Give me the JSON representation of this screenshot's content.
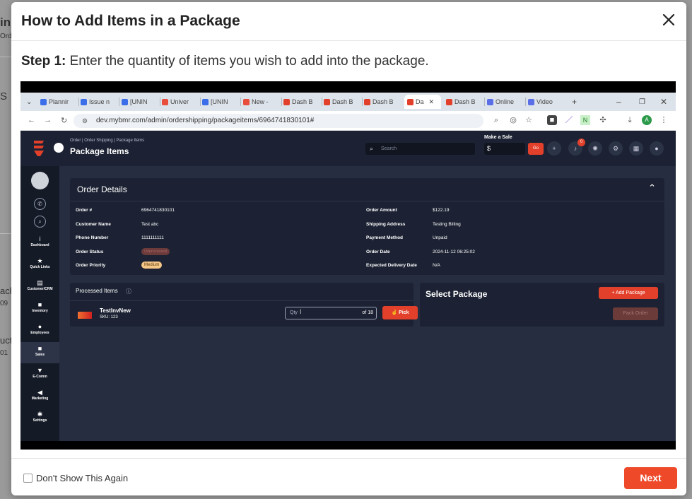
{
  "background": {
    "fragments": [
      "in",
      "Ord",
      "S",
      "ach",
      "09",
      "uct",
      "01"
    ]
  },
  "modal": {
    "title": "How to Add Items in a Package",
    "step_label": "Step 1:",
    "step_text": " Enter the quantity of items you wish to add into the package.",
    "footer": {
      "checkbox_label": "Don't Show This Again",
      "next_label": "Next"
    }
  },
  "browser": {
    "tabs": [
      {
        "label": "Plannir",
        "color": "#3b6ee8"
      },
      {
        "label": "Issue n",
        "color": "#3b6ee8"
      },
      {
        "label": "[UNIN",
        "color": "#3b6ee8"
      },
      {
        "label": "Univer",
        "color": "#e84e3b"
      },
      {
        "label": "[UNIN",
        "color": "#3b6ee8"
      },
      {
        "label": "New -",
        "color": "#e84e3b"
      },
      {
        "label": "Dash B",
        "color": "#e2402b"
      },
      {
        "label": "Dash B",
        "color": "#e2402b"
      },
      {
        "label": "Dash B",
        "color": "#e2402b"
      },
      {
        "label": "Da",
        "color": "#e2402b"
      },
      {
        "label": "Dash B",
        "color": "#e2402b"
      },
      {
        "label": "Online",
        "color": "#5a6ee8"
      },
      {
        "label": "Video",
        "color": "#5a6ee8"
      }
    ],
    "url": "dev.mybmr.com/admin/ordershipping/packageitems/6964741830101#",
    "profile_initial": "A"
  },
  "app": {
    "breadcrumb": "Order | Order Shipping | Package Items",
    "title": "Package Items",
    "search_placeholder": "Search",
    "make_sale_label": "Make a Sale",
    "sale_currency": "$",
    "go_label": "Go",
    "notif_count": "0",
    "sidebar": [
      {
        "label": "Dashboard",
        "icon": "i"
      },
      {
        "label": "Quick Links",
        "icon": "★"
      },
      {
        "label": "Customer/CRM",
        "icon": "▤"
      },
      {
        "label": "Inventory",
        "icon": "■"
      },
      {
        "label": "Employees",
        "icon": "●"
      },
      {
        "label": "Sales",
        "icon": "■"
      },
      {
        "label": "E-Comm",
        "icon": "▼"
      },
      {
        "label": "Marketing",
        "icon": "◀"
      },
      {
        "label": "Settings",
        "icon": "✱"
      }
    ],
    "order_details": {
      "title": "Order Details",
      "left": [
        {
          "label": "Order #",
          "value": "6964741830101"
        },
        {
          "label": "Customer Name",
          "value": "Test abc"
        },
        {
          "label": "Phone Number",
          "value": "1111111111"
        },
        {
          "label": "Order Status",
          "value": "Unprocessed"
        },
        {
          "label": "Order Priority",
          "value": "Medium"
        }
      ],
      "right": [
        {
          "label": "Order Amount",
          "value": "$122.19"
        },
        {
          "label": "Shipping Address",
          "value": "Testing Billing"
        },
        {
          "label": "Payment Method",
          "value": "Unpaid"
        },
        {
          "label": "Order Date",
          "value": "2024-11-12 06:25:02"
        },
        {
          "label": "Expected Delivery Date",
          "value": "N/A"
        }
      ]
    },
    "processed_items": {
      "title": "Processed Items",
      "item_name": "TestInvNew",
      "item_sku": "SKU: 123",
      "qty_placeholder": "Qty",
      "qty_of": "of 18",
      "pick_label": "Pick"
    },
    "select_package": {
      "title": "Select Package",
      "add_label": "Add Package",
      "pack_label": "Pack Order"
    }
  }
}
